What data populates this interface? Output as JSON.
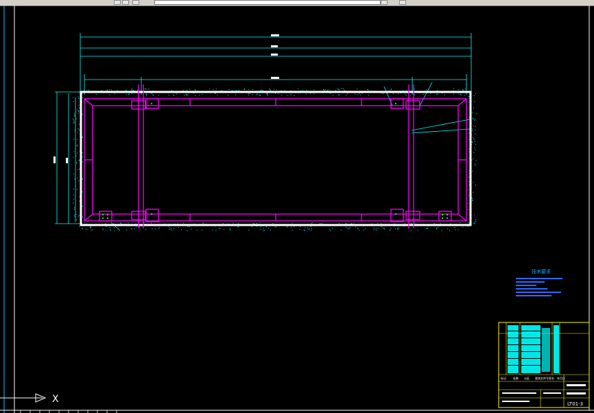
{
  "drawing": {
    "crosshair_label": "X",
    "notes_title": "技术要求",
    "title_block": {
      "drawing_number": "LT01-3",
      "header_marks": [
        "标记",
        "处数",
        "分区",
        "更改文件号",
        "签名",
        "年月日"
      ]
    }
  }
}
